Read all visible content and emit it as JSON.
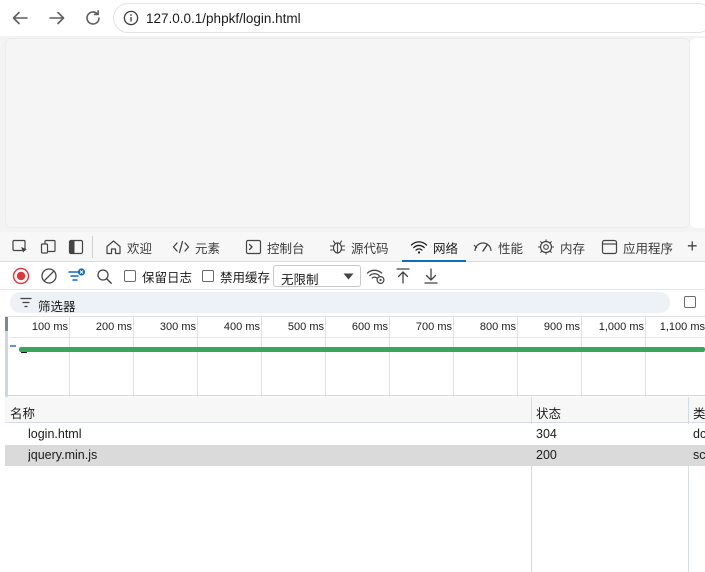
{
  "browser": {
    "url": "127.0.0.1/phpkf/login.html",
    "nav_icons": [
      "back-arrow-icon",
      "forward-arrow-icon",
      "refresh-icon",
      "info-icon"
    ]
  },
  "devtools": {
    "tabs": [
      {
        "label": "欢迎",
        "icon": "home-icon"
      },
      {
        "label": "元素",
        "icon": "code-tags-icon"
      },
      {
        "label": "控制台",
        "icon": "console-icon"
      },
      {
        "label": "源代码",
        "icon": "bug-icon"
      },
      {
        "label": "网络",
        "icon": "wifi-icon",
        "active": true
      },
      {
        "label": "性能",
        "icon": "performance-icon"
      },
      {
        "label": "内存",
        "icon": "memory-chip-icon"
      },
      {
        "label": "应用程序",
        "icon": "application-icon"
      }
    ],
    "add_tab": "+",
    "network_toolbar": {
      "preserve_log": "保留日志",
      "disable_cache": "禁用缓存",
      "throttle": "无限制"
    },
    "filter": {
      "placeholder": "筛选器"
    },
    "timeline": {
      "ticks": [
        "100 ms",
        "200 ms",
        "300 ms",
        "400 ms",
        "500 ms",
        "600 ms",
        "700 ms",
        "800 ms",
        "900 ms",
        "1,000 ms",
        "1,100 ms"
      ],
      "bar_color": "#3aa55c"
    },
    "table": {
      "headers": [
        "名称",
        "状态",
        "类"
      ],
      "rows": [
        {
          "name": "login.html",
          "status": "304",
          "type": "dc",
          "selected": false
        },
        {
          "name": "jquery.min.js",
          "status": "200",
          "type": "sc",
          "selected": true
        }
      ]
    },
    "colors": {
      "accent": "#0f6cbd",
      "record_red": "#e0353d"
    }
  }
}
